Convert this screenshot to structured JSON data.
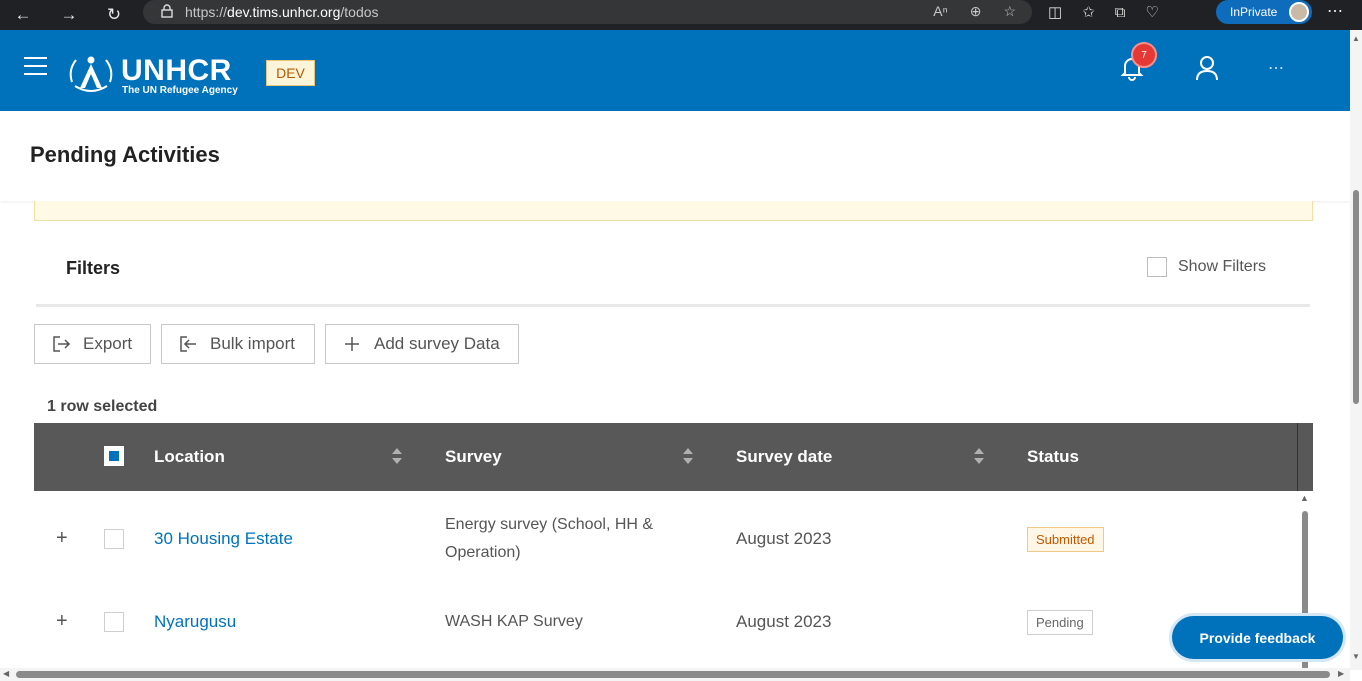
{
  "browser": {
    "url_prefix": "https://",
    "url_host": "dev.tims.unhcr.org",
    "url_path": "/todos",
    "inprivate_label": "InPrivate"
  },
  "header": {
    "brand": "UNHCR",
    "tagline": "The UN Refugee Agency",
    "env_badge": "DEV",
    "notification_count": "7",
    "colors": {
      "primary": "#0072bc",
      "badge": "#e53935"
    }
  },
  "page": {
    "title": "Pending Activities"
  },
  "filters": {
    "title": "Filters",
    "show_filters_label": "Show Filters"
  },
  "toolbar": {
    "export_label": "Export",
    "bulk_import_label": "Bulk import",
    "add_survey_label": "Add survey Data"
  },
  "selection": {
    "summary": "1 row selected"
  },
  "table": {
    "columns": [
      "Location",
      "Survey",
      "Survey date",
      "Status"
    ],
    "rows": [
      {
        "location": "30 Housing Estate",
        "survey": "Energy survey (School, HH & Operation)",
        "date": "August 2023",
        "status": "Submitted"
      },
      {
        "location": "Nyarugusu",
        "survey": "WASH KAP Survey",
        "date": "August 2023",
        "status": "Pending"
      }
    ]
  },
  "feedback": {
    "label": "Provide feedback"
  }
}
